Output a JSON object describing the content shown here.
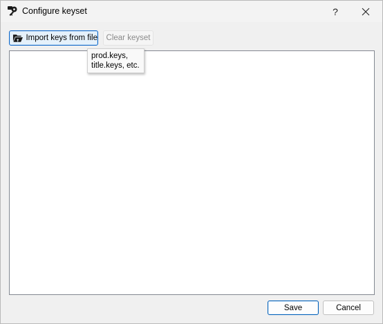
{
  "window": {
    "title": "Configure keyset",
    "help_label": "?",
    "close_label": "✕",
    "app_icon": "key-icon"
  },
  "toolbar": {
    "import_label": "Import keys from file",
    "import_icon": "folder-open-icon",
    "clear_label": "Clear keyset",
    "clear_enabled": false
  },
  "tooltip": {
    "lines": [
      "prod.keys,",
      "title.keys, etc."
    ]
  },
  "keys_list": {
    "items": []
  },
  "footer": {
    "save_label": "Save",
    "cancel_label": "Cancel"
  },
  "colors": {
    "accent": "#005fb8",
    "disabled_text": "#8a8a8a"
  }
}
